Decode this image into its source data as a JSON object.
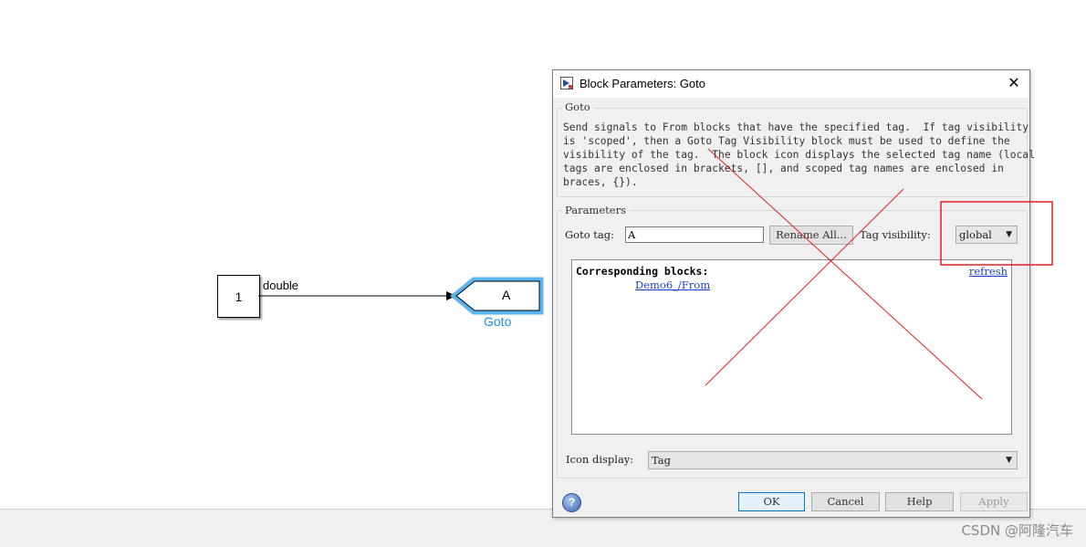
{
  "model": {
    "constant_value": "1",
    "signal_label": "double",
    "goto_tag": "A",
    "goto_block_name": "Goto"
  },
  "dialog": {
    "title": "Block Parameters: Goto",
    "close_glyph": "✕",
    "goto_section": {
      "label": "Goto",
      "description": "Send signals to From blocks that have the specified tag.  If tag visibility\nis 'scoped', then a Goto Tag Visibility block must be used to define the\nvisibility of the tag.  The block icon displays the selected tag name (local\ntags are enclosed in brackets, [], and scoped tag names are enclosed in\nbraces, {})."
    },
    "parameters": {
      "label": "Parameters",
      "goto_tag_label": "Goto tag:",
      "goto_tag_value": "A",
      "rename_all_label": "Rename All...",
      "tag_visibility_label": "Tag visibility:",
      "tag_visibility_value": "global",
      "corresponding_blocks_title": "Corresponding blocks:",
      "corresponding_blocks": [
        "Demo6_/From"
      ],
      "refresh_label": "refresh",
      "icon_display_label": "Icon display:",
      "icon_display_value": "Tag"
    },
    "buttons": {
      "ok": "OK",
      "cancel": "Cancel",
      "help": "Help",
      "apply": "Apply"
    }
  },
  "watermark": "CSDN @阿隆汽车",
  "colors": {
    "annotation_red": "#e02020",
    "goto_highlight": "#5ab4f0",
    "link_blue": "#1a3ec4"
  },
  "icons": {
    "dialog_icon": "simulink-block-icon",
    "help": "question-mark-icon",
    "dropdown": "triangle-down-icon"
  }
}
